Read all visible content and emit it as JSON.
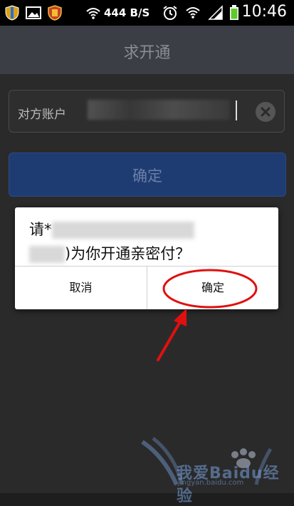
{
  "status_bar": {
    "network_speed": "444 B/S",
    "time": "10:46",
    "icons": [
      "shield-icon",
      "gallery-icon",
      "app-shield-icon",
      "wifi-icon",
      "alarm-icon",
      "signal-icon",
      "battery-icon"
    ]
  },
  "title_bar": {
    "title": "求开通"
  },
  "form": {
    "account_label": "对方账户",
    "confirm_label": "确定"
  },
  "dialog": {
    "message_prefix": "请*",
    "message_suffix": ")为你开通亲密付？",
    "cancel_label": "取消",
    "ok_label": "确定"
  },
  "watermark": {
    "brand_text": "Baidu",
    "prefix_text": "我爱",
    "suffix_text": "经验",
    "url": "jingyan.baidu.com"
  },
  "colors": {
    "annotation_red": "#e01010",
    "primary_button": "#1f3c72"
  }
}
